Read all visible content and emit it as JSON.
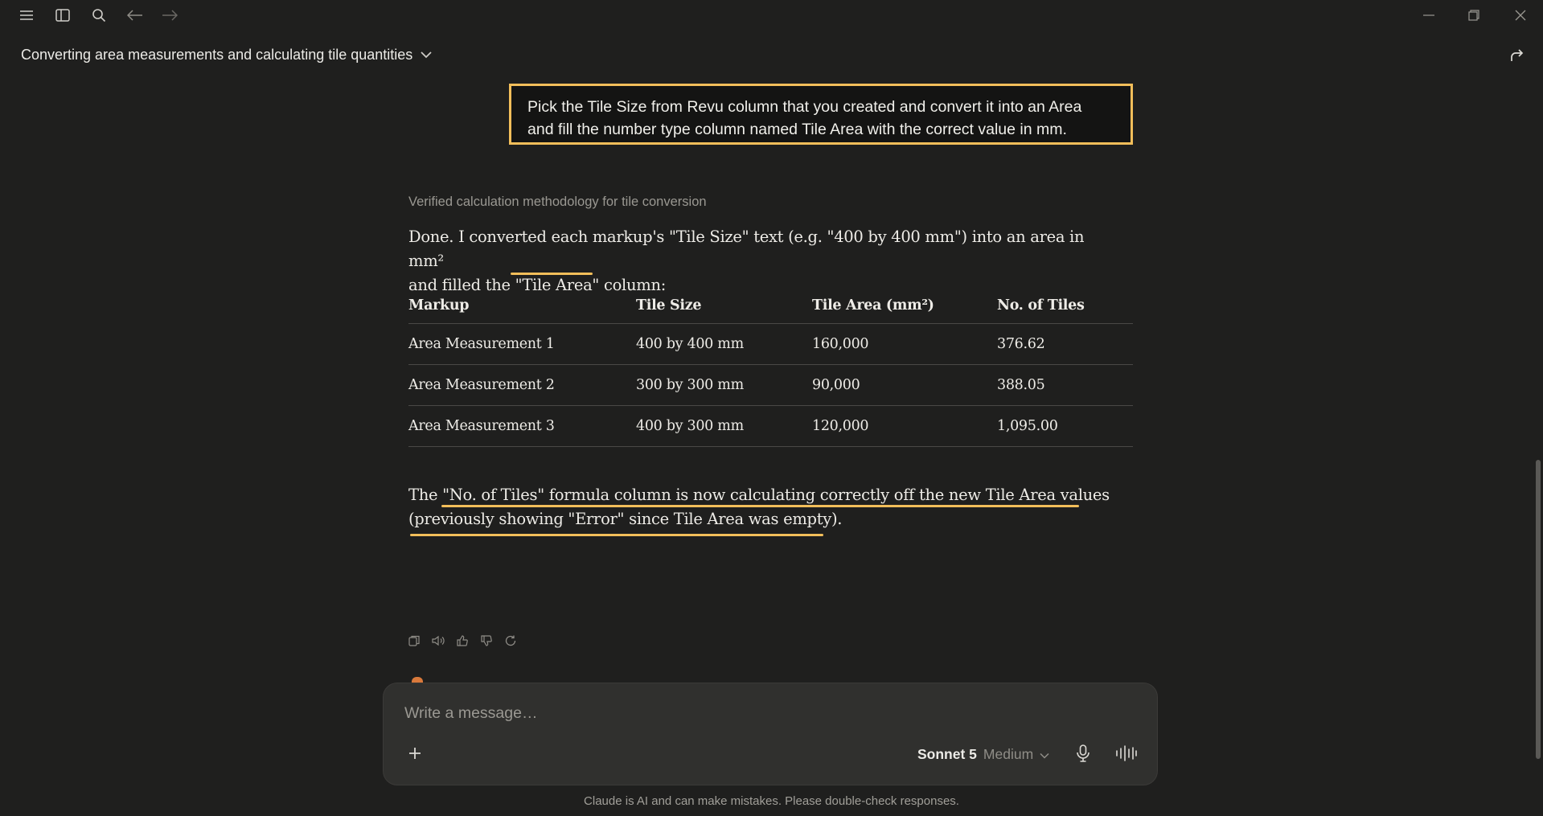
{
  "topbar": {
    "icons": [
      "menu-icon",
      "sidebar-icon",
      "search-icon",
      "back-arrow-icon",
      "forward-arrow-icon"
    ],
    "window_controls": [
      "minimize-icon",
      "restore-icon",
      "close-icon"
    ]
  },
  "conversation": {
    "title": "Converting area measurements and calculating tile quantities"
  },
  "user_message": {
    "line1": "Pick the Tile Size from Revu column that you created and convert it into an Area",
    "line2": "and fill the number type column named Tile Area with the correct value in mm."
  },
  "response": {
    "thinking_label": "Verified calculation methodology for tile conversion",
    "intro_line1": "Done. I converted each markup's \"Tile Size\" text (e.g. \"400 by 400 mm\") into an area in mm²",
    "intro_line2_pre": "and filled the ",
    "intro_line2_hl": "\"Tile Area\"",
    "intro_line2_post": " column:",
    "table": {
      "headers": [
        "Markup",
        "Tile Size",
        "Tile Area (mm²)",
        "No. of Tiles"
      ],
      "rows": [
        [
          "Area Measurement 1",
          "400 by 400 mm",
          "160,000",
          "376.62"
        ],
        [
          "Area Measurement 2",
          "300 by 300 mm",
          "90,000",
          "388.05"
        ],
        [
          "Area Measurement 3",
          "400 by 300 mm",
          "120,000",
          "1,095.00"
        ]
      ]
    },
    "closing_line1": "The \"No. of Tiles\" formula column is now calculating correctly off the new Tile Area values",
    "closing_line2": "(previously showing \"Error\" since Tile Area was empty)."
  },
  "composer": {
    "placeholder": "Write a message…",
    "model": "Sonnet 5",
    "effort": "Medium"
  },
  "footer": "Claude is AI and can make mistakes. Please double-check responses.",
  "colors": {
    "background": "#1f1f1e",
    "highlight": "#f2be5a",
    "accent": "#d9793b"
  }
}
